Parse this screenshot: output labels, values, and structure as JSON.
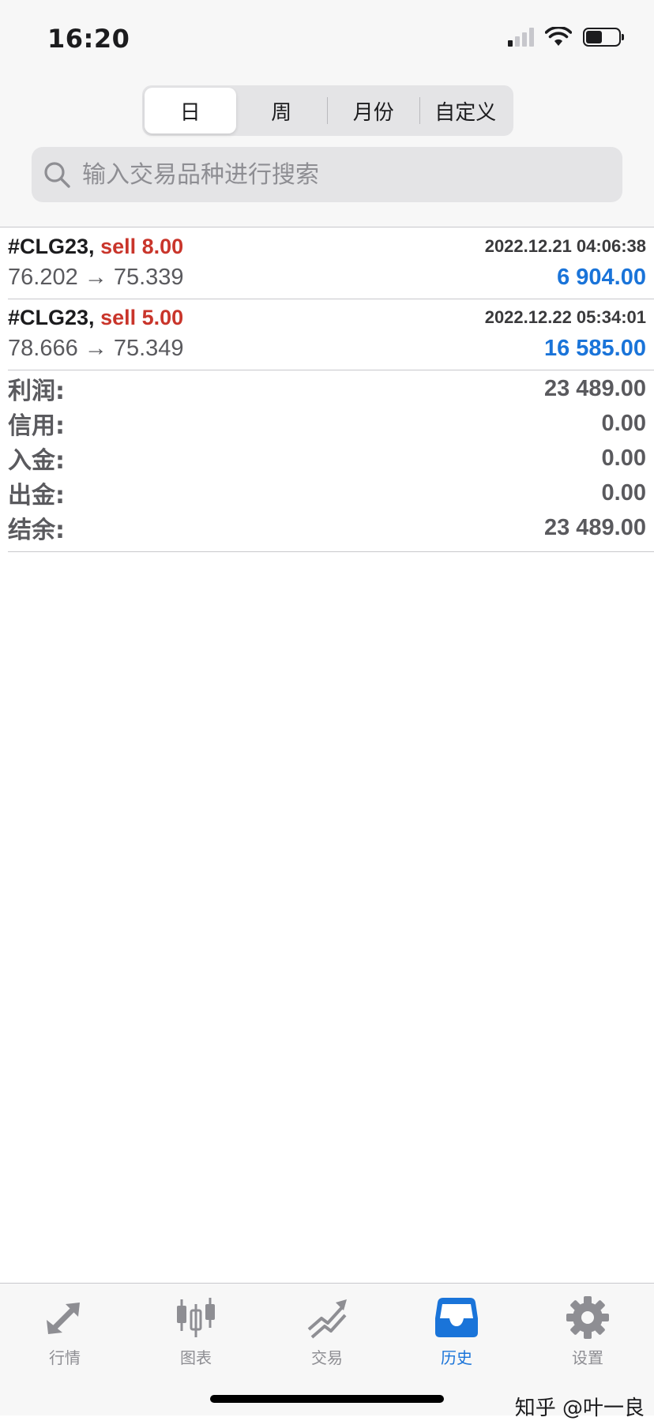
{
  "status_bar": {
    "time": "16:20"
  },
  "segments": [
    {
      "label": "日",
      "active": true
    },
    {
      "label": "周",
      "active": false
    },
    {
      "label": "月份",
      "active": false
    },
    {
      "label": "自定义",
      "active": false
    }
  ],
  "search": {
    "placeholder": "输入交易品种进行搜索",
    "value": ""
  },
  "trades": [
    {
      "symbol": "#CLG23,",
      "side": "sell 8.00",
      "time": "2022.12.21 04:06:38",
      "prices": "76.202 → 75.339",
      "profit": "6 904.00"
    },
    {
      "symbol": "#CLG23,",
      "side": "sell 5.00",
      "time": "2022.12.22 05:34:01",
      "prices": "78.666 → 75.349",
      "profit": "16 585.00"
    }
  ],
  "summary": [
    {
      "label": "利润:",
      "value": "23 489.00"
    },
    {
      "label": "信用:",
      "value": "0.00"
    },
    {
      "label": "入金:",
      "value": "0.00"
    },
    {
      "label": "出金:",
      "value": "0.00"
    },
    {
      "label": "结余:",
      "value": "23 489.00"
    }
  ],
  "tabs": [
    {
      "label": "行情",
      "icon": "quotes-arrows-icon",
      "active": false
    },
    {
      "label": "图表",
      "icon": "candlestick-chart-icon",
      "active": false
    },
    {
      "label": "交易",
      "icon": "trade-trend-icon",
      "active": false
    },
    {
      "label": "历史",
      "icon": "history-inbox-icon",
      "active": true
    },
    {
      "label": "设置",
      "icon": "gear-icon",
      "active": false
    }
  ],
  "watermark": "知乎 @叶一良",
  "colors": {
    "sell": "#c9352b",
    "profit": "#1a74d9",
    "active_tab": "#1a74d9",
    "inactive_tab": "#8e8e93"
  }
}
